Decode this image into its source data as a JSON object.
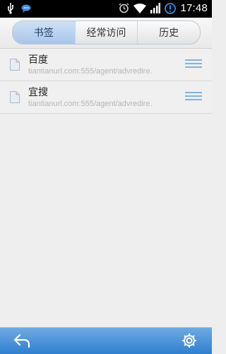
{
  "status_bar": {
    "time": "17:48",
    "icons": [
      "usb-icon",
      "chat-icon",
      "alarm-icon",
      "wifi-icon",
      "signal-icon",
      "sync-icon"
    ]
  },
  "tabs": [
    {
      "label": "书签",
      "active": true
    },
    {
      "label": "经常访问",
      "active": false
    },
    {
      "label": "历史",
      "active": false
    }
  ],
  "bookmarks": [
    {
      "title": "百度",
      "url": "tiantianurl.com:555/agent/advredire."
    },
    {
      "title": "宜搜",
      "url": "tiantianurl.com:555/agent/advredire."
    }
  ],
  "bottom_bar": {
    "icons": [
      "back-arrow-icon",
      "gear-icon"
    ]
  },
  "colors": {
    "accent": "#3a8bd8",
    "active_tab": "#b7d0ee"
  }
}
